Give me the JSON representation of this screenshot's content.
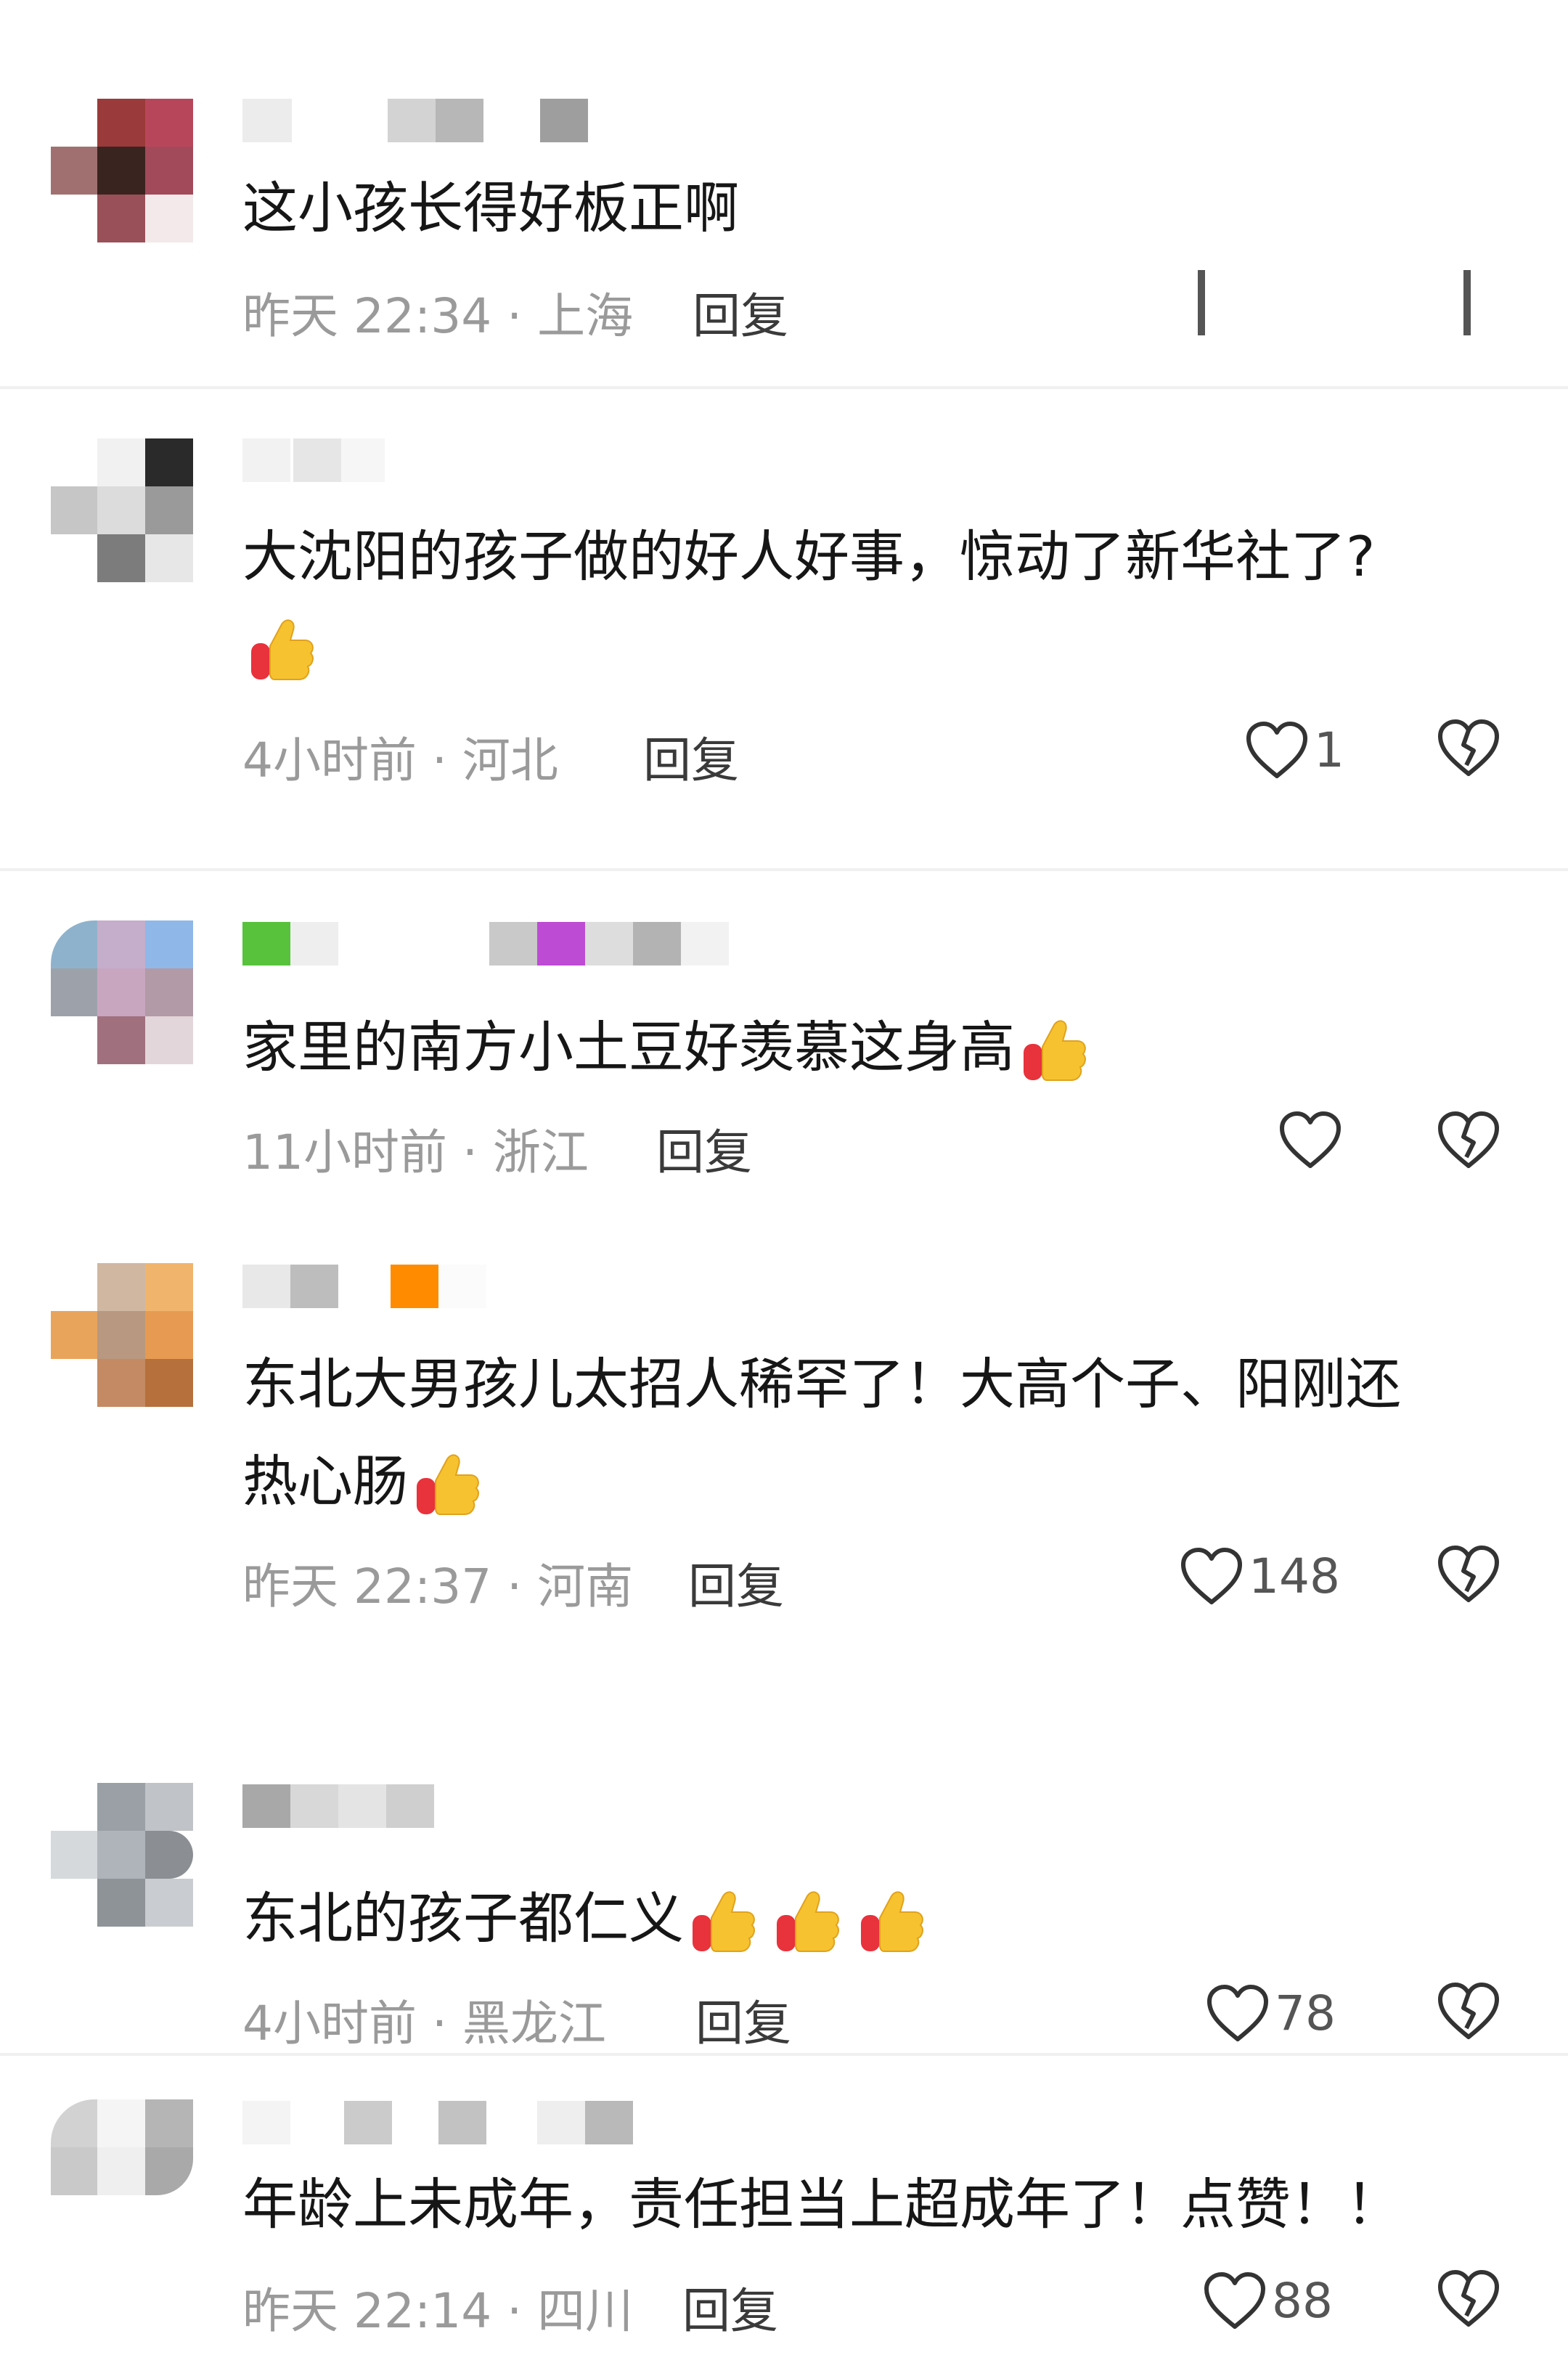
{
  "comments": [
    {
      "text": "这小孩长得好板正啊",
      "meta": "昨天 22:34 · 上海",
      "reply_label": "回复",
      "like_count": ""
    },
    {
      "text": "大沈阳的孩子做的好人好事，惊动了新华社了?",
      "meta": "4小时前 · 河北",
      "reply_label": "回复",
      "like_count": "1"
    },
    {
      "text": "家里的南方小土豆好羡慕这身高",
      "meta": "11小时前 · 浙江",
      "reply_label": "回复",
      "like_count": ""
    },
    {
      "text_line1": "东北大男孩儿太招人稀罕了！大高个子、阳刚还",
      "text_line2": "热心肠",
      "meta": "昨天 22:37 · 河南",
      "reply_label": "回复",
      "like_count": "148"
    },
    {
      "text": "东北的孩子都仁义",
      "meta": "4小时前 · 黑龙江",
      "reply_label": "回复",
      "like_count": "78"
    },
    {
      "text": "年龄上未成年，责任担当上超成年了！点赞！！",
      "meta": "昨天 22:14 · 四川",
      "reply_label": "回复",
      "like_count": "88"
    }
  ],
  "icons": {
    "like": "heart-outline-icon",
    "dislike": "broken-heart-icon",
    "emoji": "thumbs-up-emoji"
  },
  "colors": {
    "text": "#161616",
    "meta": "#9a9a9a",
    "icon": "#333333",
    "thumb": "#f7c22f"
  }
}
